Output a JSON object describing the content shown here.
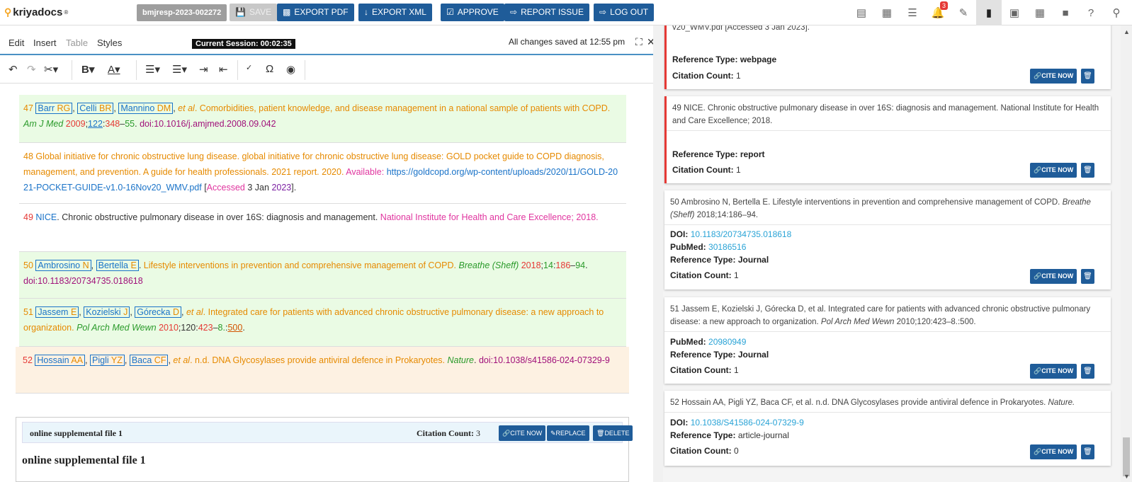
{
  "app": {
    "logo": "kriyadocs",
    "doc_id": "bmjresp-2023-002272"
  },
  "topbar": {
    "save": "SAVE",
    "export_pdf": "EXPORT PDF",
    "export_xml": "EXPORT XML",
    "approve": "APPROVE",
    "report_issue": "REPORT ISSUE",
    "logout": "LOG OUT",
    "notifications": "3"
  },
  "menubar": {
    "edit": "Edit",
    "insert": "Insert",
    "table": "Table",
    "styles": "Styles",
    "session": "Current Session: 00:02:35",
    "saved": "All changes saved at 12:55 pm"
  },
  "refs": {
    "r47": {
      "num": "47",
      "a1s": "Barr",
      "a1i": "RG",
      "a2s": "Celli",
      "a2i": "BR",
      "a3s": "Mannino",
      "a3i": "DM",
      "etal": "et al",
      "title": "Comorbidities, patient knowledge, and disease management in a national sample of patients with COPD.",
      "journal": "Am J Med",
      "year": "2009",
      "vol": "122",
      "fpage": "348",
      "dash": "–",
      "lpage": "55",
      "doi": "doi:10.1016/j.amjmed.2008.09.042"
    },
    "r48": {
      "num": "48",
      "title": "Global initiative for chronic obstructive lung disease. global initiative for chronic obstructive lung disease: GOLD pocket guide to COPD diagnosis, management, and prevention. A guide for health professionals. 2021 report.",
      "year": "2020",
      "available": "Available:",
      "url": "https://goldcopd.org/wp-content/uploads/2020/11/GOLD-2021-POCKET-GUIDE-v1.0-16Nov20_WMV.pdf",
      "accessed": "Accessed",
      "adate": "3 Jan",
      "ayear": "2023"
    },
    "r49": {
      "num": "49",
      "author": "NICE",
      "title": "Chronic obstructive pulmonary disease in over 16S: diagnosis and management.",
      "publisher": "National Institute for Health and Care Excellence",
      "year": "2018"
    },
    "r50": {
      "num": "50",
      "a1s": "Ambrosino",
      "a1i": "N",
      "a2s": "Bertella",
      "a2i": "E",
      "title": "Lifestyle interventions in prevention and comprehensive management of COPD.",
      "journal": "Breathe (Sheff)",
      "year": "2018",
      "vol": "14",
      "fpage": "186",
      "lpage": "94",
      "doi": "doi:10.1183/20734735.018618"
    },
    "r51": {
      "num": "51",
      "a1s": "Jassem",
      "a1i": "E",
      "a2s": "Kozielski",
      "a2i": "J",
      "a3s": "Górecka",
      "a3i": "D",
      "etal": "et al",
      "title": "Integrated care for patients with advanced chronic obstructive pulmonary disease: a new approach to organization.",
      "journal": "Pol Arch Med Wewn",
      "year": "2010",
      "vol": "120",
      "fpage": "423",
      "lpage": "8.",
      "extra": "500"
    },
    "r52": {
      "num": "52",
      "a1s": "Hossain",
      "a1i": "AA",
      "a2s": "Pigli",
      "a2i": "YZ",
      "a3s": "Baca",
      "a3i": "CF",
      "etal": "et al",
      "nd": "n.d.",
      "title": "DNA Glycosylases provide antiviral defence in Prokaryotes.",
      "journal": "Nature",
      "doi": "doi:10.1038/s41586-024-07329-9"
    }
  },
  "supplement": {
    "title": "online supplemental file 1",
    "cc_label": "Citation Count:",
    "cc": "3",
    "cite": "CITE NOW",
    "replace": "REPLACE",
    "delete": "DELETE",
    "heading": "online supplemental file 1"
  },
  "panel": {
    "labels": {
      "reftype": "Reference Type:",
      "cc": "Citation Count:",
      "doi": "DOI:",
      "pubmed": "PubMed:",
      "cite": "CITE NOW"
    },
    "c48": {
      "top": "v20_WMV.pdf [Accessed 3 Jan 2023].",
      "reftype": "webpage",
      "cc": "1"
    },
    "c49": {
      "cite": "49 NICE. Chronic obstructive pulmonary disease in over 16S: diagnosis and management. National Institute for Health and Care Excellence; 2018.",
      "reftype": "report",
      "cc": "1"
    },
    "c50": {
      "cite_a": "50 Ambrosino N, Bertella E. Lifestyle interventions in prevention and comprehensive management of COPD.",
      "cite_j": "Breathe (Sheff)",
      "cite_b": "2018;14:186–94.",
      "doi": "10.1183/20734735.018618",
      "pubmed": "30186516",
      "reftype": "Journal",
      "cc": "1"
    },
    "c51": {
      "cite_a": "51 Jassem E, Kozielski J, Górecka D, et al. Integrated care for patients with advanced chronic obstructive pulmonary disease: a new approach to organization.",
      "cite_j": "Pol Arch Med Wewn",
      "cite_b": "2010;120:423–8.:500.",
      "pubmed": "20980949",
      "reftype": "Journal",
      "cc": "1"
    },
    "c52": {
      "cite_a": "52 Hossain AA, Pigli YZ, Baca CF, et al. n.d. DNA Glycosylases provide antiviral defence in Prokaryotes.",
      "cite_j": "Nature.",
      "doi": "10.1038/S41586-024-07329-9",
      "reftype": "article-journal",
      "cc": "0"
    }
  },
  "colors": {
    "accent": "#1f5c99",
    "flag": "#e53935",
    "link": "#29a3d6",
    "green_bg": "#eafbe4",
    "orange_bg": "#fdf1e2"
  }
}
